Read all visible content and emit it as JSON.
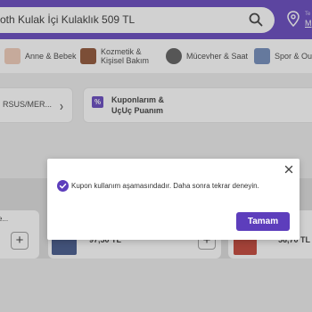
{
  "header": {
    "search_value": "oth Kulak İçi Kulaklık 509 TL",
    "location_small": "Te",
    "location_big": "M"
  },
  "categories": [
    {
      "label": "Anne & Bebek",
      "icon": "baby-product-icon",
      "color": "#f0c9b5"
    },
    {
      "label": "Kozmetik &\nKişisel Bakım",
      "icon": "brush-icon",
      "color": "#8a4a2a"
    },
    {
      "label": "Mücevher & Saat",
      "icon": "watch-icon",
      "color": "#555555"
    },
    {
      "label": "Spor & Ou",
      "icon": "sport-icon",
      "color": "#6a85b8"
    }
  ],
  "cards": {
    "card1_label": "RSUS/MER...",
    "card2_label_line1": "Kuponlarım &",
    "card2_label_line2": "UçUç Puanım",
    "card2_icon": "%"
  },
  "products": {
    "left_name": "e...",
    "add_symbol": "+",
    "mid_price": "97,50 TL",
    "right_price": "56,70 TL"
  },
  "modal": {
    "message": "Kupon kullanım aşamasındadır. Daha sonra tekrar deneyin.",
    "ok_label": "Tamam"
  },
  "colors": {
    "accent": "#5d3ebc"
  }
}
